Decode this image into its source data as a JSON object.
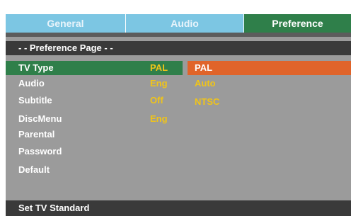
{
  "tabs": [
    {
      "label": "General",
      "active": false
    },
    {
      "label": "Audio",
      "active": false
    },
    {
      "label": "Preference",
      "active": true
    }
  ],
  "page_header": "- - Preference Page - -",
  "menu_items": [
    {
      "label": "TV Type",
      "value": "PAL",
      "selected": true
    },
    {
      "label": "Audio",
      "value": "Eng",
      "selected": false
    },
    {
      "label": "Subtitle",
      "value": "Off",
      "selected": false
    },
    {
      "label": "DiscMenu",
      "value": "Eng",
      "selected": false
    },
    {
      "label": "Parental",
      "value": "",
      "selected": false
    },
    {
      "label": "Password",
      "value": "",
      "selected": false
    },
    {
      "label": "Default",
      "value": "",
      "selected": false
    }
  ],
  "options": [
    {
      "label": "PAL",
      "selected": true
    },
    {
      "label": "Auto",
      "selected": false
    },
    {
      "label": "NTSC",
      "selected": false
    }
  ],
  "status_text": "Set TV Standard",
  "colors": {
    "tab_inactive": "#7cc6e3",
    "tab_active": "#2f7f4a",
    "panel": "#9b9b9b",
    "header_bar": "#3a3a3a",
    "row_selected": "#2f7f4a",
    "option_selected": "#e0642a",
    "value_text": "#f0c419"
  }
}
